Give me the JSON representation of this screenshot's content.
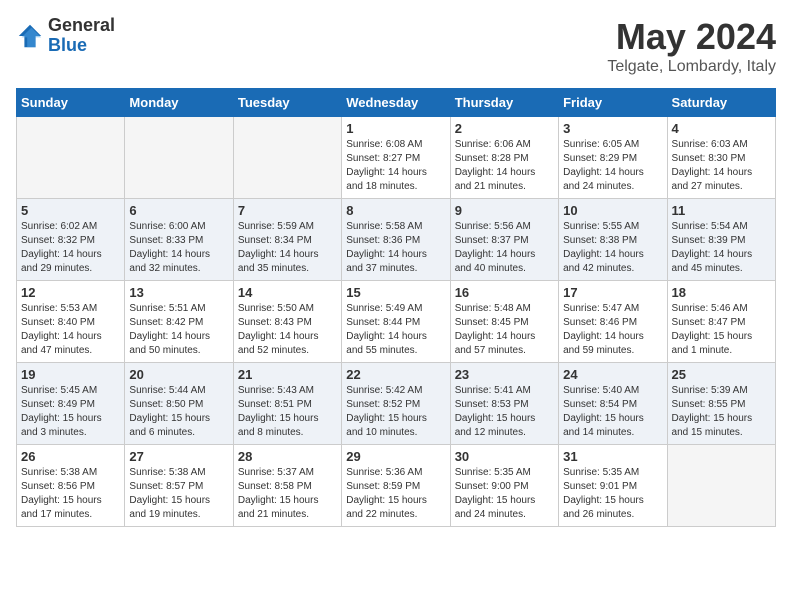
{
  "header": {
    "logo_general": "General",
    "logo_blue": "Blue",
    "month_title": "May 2024",
    "location": "Telgate, Lombardy, Italy"
  },
  "weekdays": [
    "Sunday",
    "Monday",
    "Tuesday",
    "Wednesday",
    "Thursday",
    "Friday",
    "Saturday"
  ],
  "weeks": [
    [
      {
        "day": "",
        "empty": true
      },
      {
        "day": "",
        "empty": true
      },
      {
        "day": "",
        "empty": true
      },
      {
        "day": "1",
        "info": "Sunrise: 6:08 AM\nSunset: 8:27 PM\nDaylight: 14 hours\nand 18 minutes."
      },
      {
        "day": "2",
        "info": "Sunrise: 6:06 AM\nSunset: 8:28 PM\nDaylight: 14 hours\nand 21 minutes."
      },
      {
        "day": "3",
        "info": "Sunrise: 6:05 AM\nSunset: 8:29 PM\nDaylight: 14 hours\nand 24 minutes."
      },
      {
        "day": "4",
        "info": "Sunrise: 6:03 AM\nSunset: 8:30 PM\nDaylight: 14 hours\nand 27 minutes."
      }
    ],
    [
      {
        "day": "5",
        "info": "Sunrise: 6:02 AM\nSunset: 8:32 PM\nDaylight: 14 hours\nand 29 minutes."
      },
      {
        "day": "6",
        "info": "Sunrise: 6:00 AM\nSunset: 8:33 PM\nDaylight: 14 hours\nand 32 minutes."
      },
      {
        "day": "7",
        "info": "Sunrise: 5:59 AM\nSunset: 8:34 PM\nDaylight: 14 hours\nand 35 minutes."
      },
      {
        "day": "8",
        "info": "Sunrise: 5:58 AM\nSunset: 8:36 PM\nDaylight: 14 hours\nand 37 minutes."
      },
      {
        "day": "9",
        "info": "Sunrise: 5:56 AM\nSunset: 8:37 PM\nDaylight: 14 hours\nand 40 minutes."
      },
      {
        "day": "10",
        "info": "Sunrise: 5:55 AM\nSunset: 8:38 PM\nDaylight: 14 hours\nand 42 minutes."
      },
      {
        "day": "11",
        "info": "Sunrise: 5:54 AM\nSunset: 8:39 PM\nDaylight: 14 hours\nand 45 minutes."
      }
    ],
    [
      {
        "day": "12",
        "info": "Sunrise: 5:53 AM\nSunset: 8:40 PM\nDaylight: 14 hours\nand 47 minutes."
      },
      {
        "day": "13",
        "info": "Sunrise: 5:51 AM\nSunset: 8:42 PM\nDaylight: 14 hours\nand 50 minutes."
      },
      {
        "day": "14",
        "info": "Sunrise: 5:50 AM\nSunset: 8:43 PM\nDaylight: 14 hours\nand 52 minutes."
      },
      {
        "day": "15",
        "info": "Sunrise: 5:49 AM\nSunset: 8:44 PM\nDaylight: 14 hours\nand 55 minutes."
      },
      {
        "day": "16",
        "info": "Sunrise: 5:48 AM\nSunset: 8:45 PM\nDaylight: 14 hours\nand 57 minutes."
      },
      {
        "day": "17",
        "info": "Sunrise: 5:47 AM\nSunset: 8:46 PM\nDaylight: 14 hours\nand 59 minutes."
      },
      {
        "day": "18",
        "info": "Sunrise: 5:46 AM\nSunset: 8:47 PM\nDaylight: 15 hours\nand 1 minute."
      }
    ],
    [
      {
        "day": "19",
        "info": "Sunrise: 5:45 AM\nSunset: 8:49 PM\nDaylight: 15 hours\nand 3 minutes."
      },
      {
        "day": "20",
        "info": "Sunrise: 5:44 AM\nSunset: 8:50 PM\nDaylight: 15 hours\nand 6 minutes."
      },
      {
        "day": "21",
        "info": "Sunrise: 5:43 AM\nSunset: 8:51 PM\nDaylight: 15 hours\nand 8 minutes."
      },
      {
        "day": "22",
        "info": "Sunrise: 5:42 AM\nSunset: 8:52 PM\nDaylight: 15 hours\nand 10 minutes."
      },
      {
        "day": "23",
        "info": "Sunrise: 5:41 AM\nSunset: 8:53 PM\nDaylight: 15 hours\nand 12 minutes."
      },
      {
        "day": "24",
        "info": "Sunrise: 5:40 AM\nSunset: 8:54 PM\nDaylight: 15 hours\nand 14 minutes."
      },
      {
        "day": "25",
        "info": "Sunrise: 5:39 AM\nSunset: 8:55 PM\nDaylight: 15 hours\nand 15 minutes."
      }
    ],
    [
      {
        "day": "26",
        "info": "Sunrise: 5:38 AM\nSunset: 8:56 PM\nDaylight: 15 hours\nand 17 minutes."
      },
      {
        "day": "27",
        "info": "Sunrise: 5:38 AM\nSunset: 8:57 PM\nDaylight: 15 hours\nand 19 minutes."
      },
      {
        "day": "28",
        "info": "Sunrise: 5:37 AM\nSunset: 8:58 PM\nDaylight: 15 hours\nand 21 minutes."
      },
      {
        "day": "29",
        "info": "Sunrise: 5:36 AM\nSunset: 8:59 PM\nDaylight: 15 hours\nand 22 minutes."
      },
      {
        "day": "30",
        "info": "Sunrise: 5:35 AM\nSunset: 9:00 PM\nDaylight: 15 hours\nand 24 minutes."
      },
      {
        "day": "31",
        "info": "Sunrise: 5:35 AM\nSunset: 9:01 PM\nDaylight: 15 hours\nand 26 minutes."
      },
      {
        "day": "",
        "empty": true
      }
    ]
  ]
}
